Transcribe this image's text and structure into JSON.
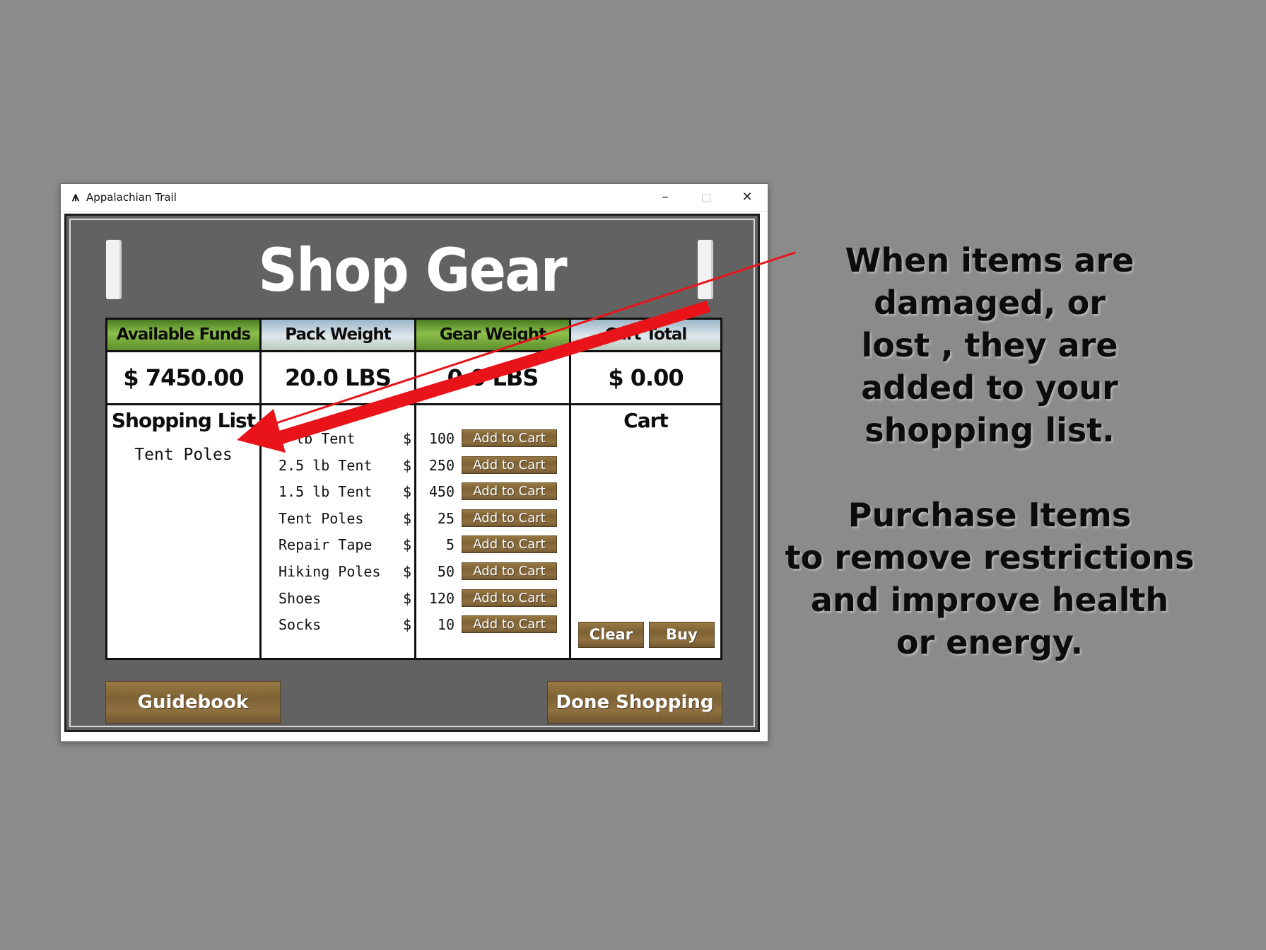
{
  "window": {
    "title": "Appalachian Trail",
    "icon": "trail-logo-icon",
    "controls": {
      "minimize": "–",
      "maximize": "□",
      "close": "✕"
    }
  },
  "game": {
    "title": "Shop Gear",
    "stats": [
      {
        "label": "Available Funds",
        "value": "$ 7450.00"
      },
      {
        "label": "Pack Weight",
        "value": "20.0 LBS"
      },
      {
        "label": "Gear Weight",
        "value": "0.0 LBS"
      },
      {
        "label": "Cart Total",
        "value": "$ 0.00"
      }
    ],
    "shopping_list": {
      "title": "Shopping List",
      "items": [
        "Tent Poles"
      ]
    },
    "store_items": [
      {
        "name": "4 lb Tent",
        "currency": "$",
        "price": "100",
        "button": "Add to Cart"
      },
      {
        "name": "2.5 lb Tent",
        "currency": "$",
        "price": "250",
        "button": "Add to Cart"
      },
      {
        "name": "1.5 lb Tent",
        "currency": "$",
        "price": "450",
        "button": "Add to Cart"
      },
      {
        "name": "Tent Poles",
        "currency": "$",
        "price": "25",
        "button": "Add to Cart"
      },
      {
        "name": "Repair Tape",
        "currency": "$",
        "price": "5",
        "button": "Add to Cart"
      },
      {
        "name": "Hiking Poles",
        "currency": "$",
        "price": "50",
        "button": "Add to Cart"
      },
      {
        "name": "Shoes",
        "currency": "$",
        "price": "120",
        "button": "Add to Cart"
      },
      {
        "name": "Socks",
        "currency": "$",
        "price": "10",
        "button": "Add to Cart"
      }
    ],
    "cart": {
      "title": "Cart",
      "clear_label": "Clear",
      "buy_label": "Buy"
    },
    "buttons": {
      "guidebook": "Guidebook",
      "done": "Done Shopping"
    }
  },
  "annotation": {
    "paragraph1": "When items are\ndamaged, or\nlost , they are\nadded to your\nshopping list.",
    "paragraph2": "Purchase Items\nto remove restrictions\nand improve health\nor energy.",
    "arrow_color": "#e8141a"
  }
}
